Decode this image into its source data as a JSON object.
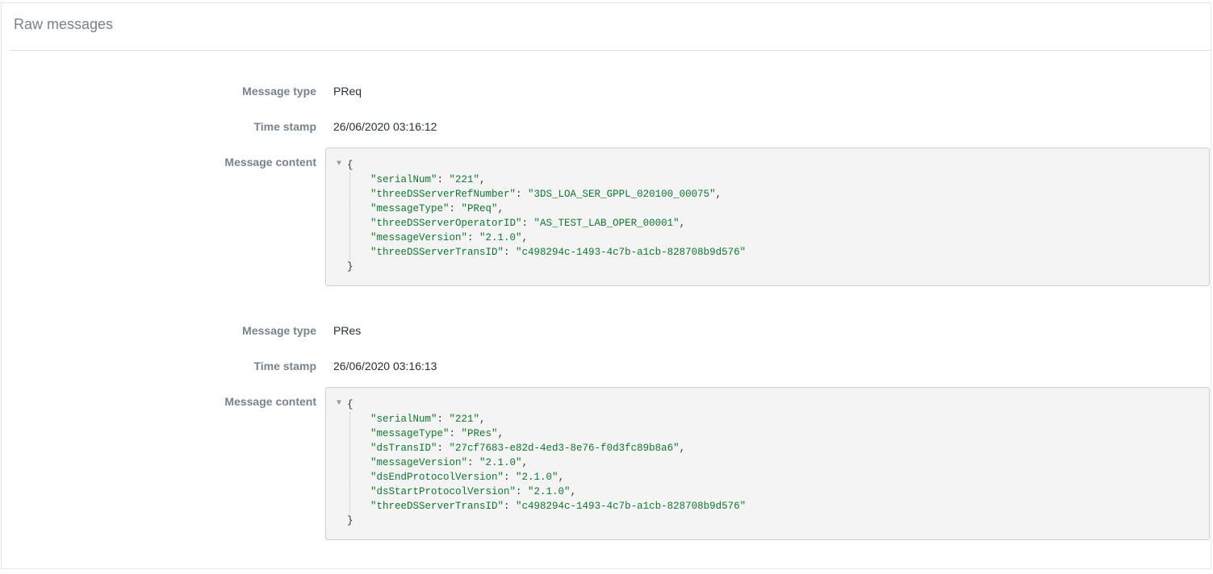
{
  "panel": {
    "title": "Raw messages"
  },
  "messages": [
    {
      "type_label": "Message type",
      "type_value": "PReq",
      "timestamp_label": "Time stamp",
      "timestamp_value": "26/06/2020 03:16:12",
      "content_label": "Message content",
      "toggle_icon": "collapse-triangle-icon",
      "open_brace": "{",
      "close_brace": "}",
      "fields": [
        {
          "key": "\"serialNum\"",
          "value": "\"221\""
        },
        {
          "key": "\"threeDSServerRefNumber\"",
          "value": "\"3DS_LOA_SER_GPPL_020100_00075\""
        },
        {
          "key": "\"messageType\"",
          "value": "\"PReq\""
        },
        {
          "key": "\"threeDSServerOperatorID\"",
          "value": "\"AS_TEST_LAB_OPER_00001\""
        },
        {
          "key": "\"messageVersion\"",
          "value": "\"2.1.0\""
        },
        {
          "key": "\"threeDSServerTransID\"",
          "value": "\"c498294c-1493-4c7b-a1cb-828708b9d576\""
        }
      ]
    },
    {
      "type_label": "Message type",
      "type_value": "PRes",
      "timestamp_label": "Time stamp",
      "timestamp_value": "26/06/2020 03:16:13",
      "content_label": "Message content",
      "toggle_icon": "collapse-triangle-icon",
      "open_brace": "{",
      "close_brace": "}",
      "fields": [
        {
          "key": "\"serialNum\"",
          "value": "\"221\""
        },
        {
          "key": "\"messageType\"",
          "value": "\"PRes\""
        },
        {
          "key": "\"dsTransID\"",
          "value": "\"27cf7683-e82d-4ed3-8e76-f0d3fc89b8a6\""
        },
        {
          "key": "\"messageVersion\"",
          "value": "\"2.1.0\""
        },
        {
          "key": "\"dsEndProtocolVersion\"",
          "value": "\"2.1.0\""
        },
        {
          "key": "\"dsStartProtocolVersion\"",
          "value": "\"2.1.0\""
        },
        {
          "key": "\"threeDSServerTransID\"",
          "value": "\"c498294c-1493-4c7b-a1cb-828708b9d576\""
        }
      ]
    }
  ],
  "colors": {
    "label": "#76838f",
    "value": "#263238",
    "json_value": "#0b7a2c",
    "code_bg": "#f4f4f4"
  }
}
